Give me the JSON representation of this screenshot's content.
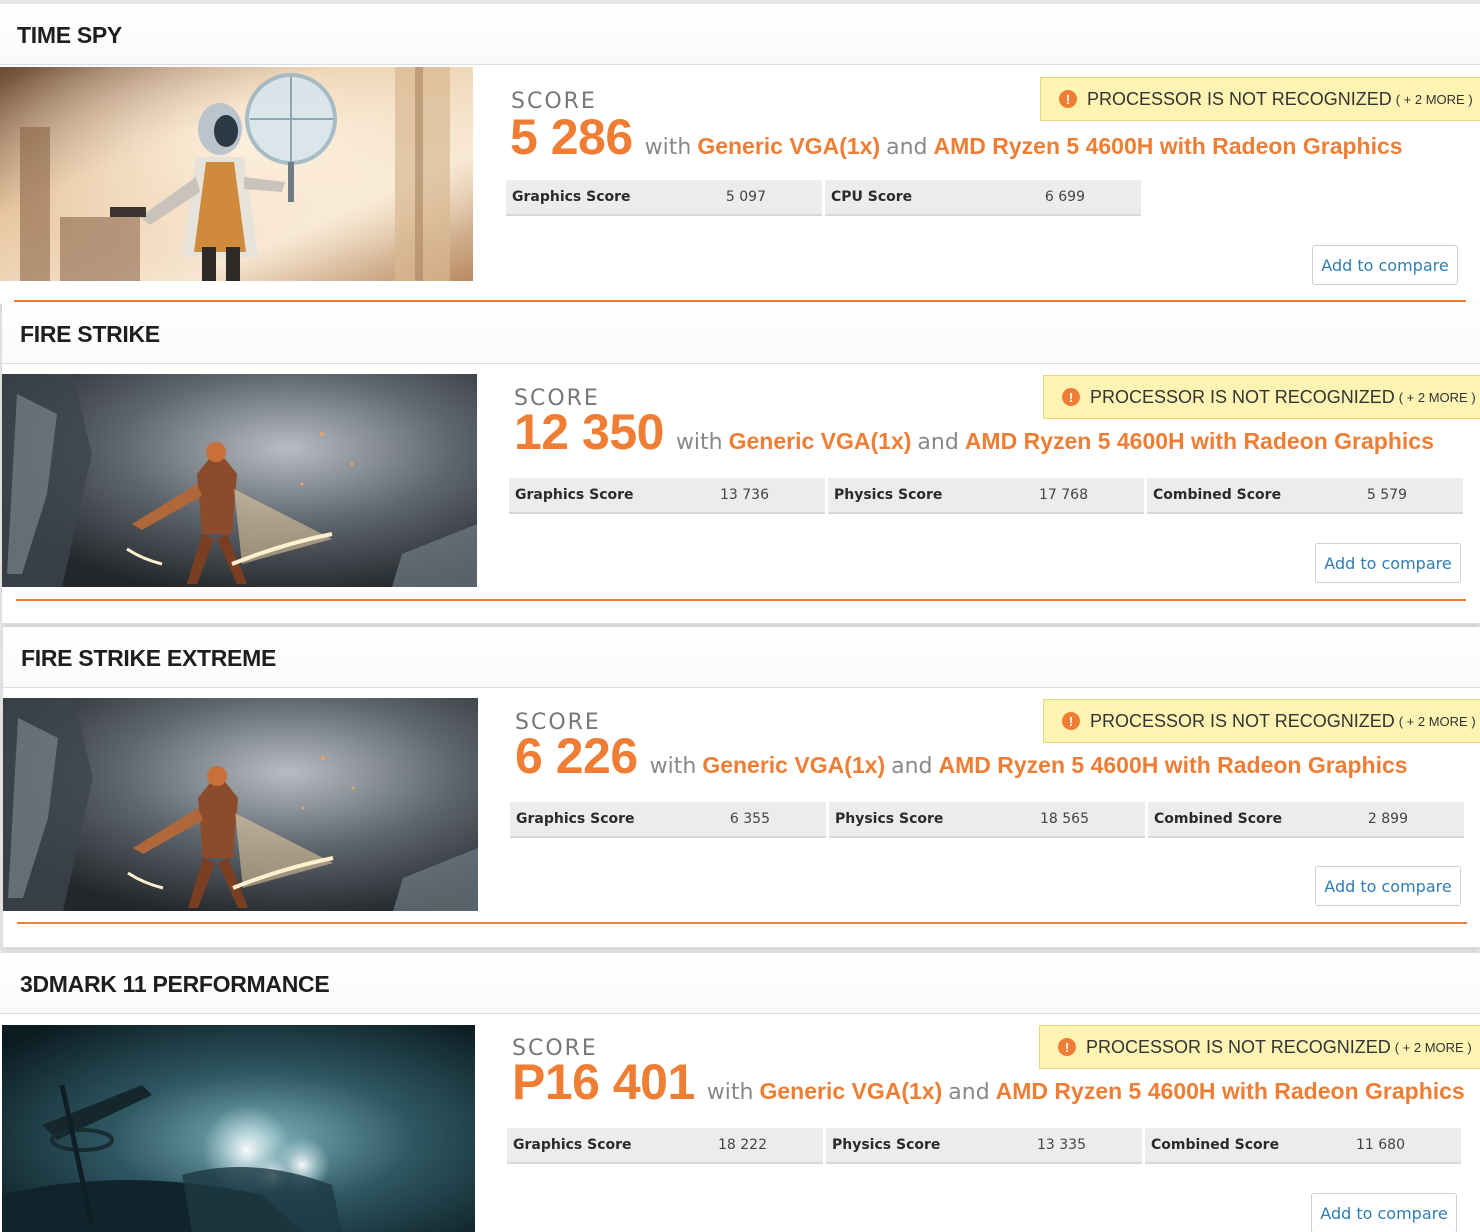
{
  "benchmarks": [
    {
      "title": "TIME SPY",
      "score_label": "SCORE",
      "score": "5 286",
      "with_word": "with",
      "gpu": "Generic VGA(1x)",
      "and_word": "and",
      "cpu": "AMD Ryzen 5 4600H with Radeon Graphics",
      "warning": "PROCESSOR IS NOT RECOGNIZED",
      "warning_more": "( + 2 MORE )",
      "subscores": [
        {
          "label": "Graphics Score",
          "value": "5 097"
        },
        {
          "label": "CPU Score",
          "value": "6 699"
        }
      ],
      "compare_label": "Add to compare"
    },
    {
      "title": "FIRE STRIKE",
      "score_label": "SCORE",
      "score": "12 350",
      "with_word": "with",
      "gpu": "Generic VGA(1x)",
      "and_word": "and",
      "cpu": "AMD Ryzen 5 4600H with Radeon Graphics",
      "warning": "PROCESSOR IS NOT RECOGNIZED",
      "warning_more": "( + 2 MORE )",
      "subscores": [
        {
          "label": "Graphics Score",
          "value": "13 736"
        },
        {
          "label": "Physics Score",
          "value": "17 768"
        },
        {
          "label": "Combined Score",
          "value": "5 579"
        }
      ],
      "compare_label": "Add to compare"
    },
    {
      "title": "FIRE STRIKE EXTREME",
      "score_label": "SCORE",
      "score": "6 226",
      "with_word": "with",
      "gpu": "Generic VGA(1x)",
      "and_word": "and",
      "cpu": "AMD Ryzen 5 4600H with Radeon Graphics",
      "warning": "PROCESSOR IS NOT RECOGNIZED",
      "warning_more": "( + 2 MORE )",
      "subscores": [
        {
          "label": "Graphics Score",
          "value": "6 355"
        },
        {
          "label": "Physics Score",
          "value": "18 565"
        },
        {
          "label": "Combined Score",
          "value": "2 899"
        }
      ],
      "compare_label": "Add to compare"
    },
    {
      "title": "3DMARK 11 PERFORMANCE",
      "score_label": "SCORE",
      "score": "P16 401",
      "with_word": "with",
      "gpu": "Generic VGA(1x)",
      "and_word": "and",
      "cpu": "AMD Ryzen 5 4600H with Radeon Graphics",
      "warning": "PROCESSOR IS NOT RECOGNIZED",
      "warning_more": "( + 2 MORE )",
      "subscores": [
        {
          "label": "Graphics Score",
          "value": "18 222"
        },
        {
          "label": "Physics Score",
          "value": "13 335"
        },
        {
          "label": "Combined Score",
          "value": "11 680"
        }
      ],
      "compare_label": "Add to compare"
    }
  ],
  "thumbnails": [
    "time-spy-scene",
    "fire-strike-scene",
    "fire-strike-scene",
    "3dmark-11-scene"
  ],
  "colors": {
    "accent": "#ef7e34",
    "warning_bg": "#fdf3b3",
    "link": "#2e7db5"
  }
}
